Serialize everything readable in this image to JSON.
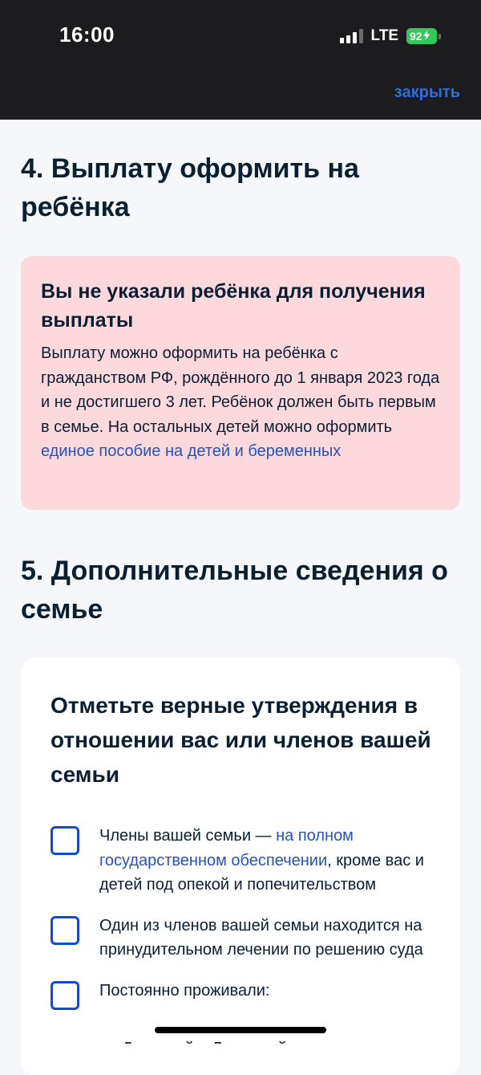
{
  "status_bar": {
    "time": "16:00",
    "network": "LTE",
    "battery": "92",
    "battery_color": "#34c759"
  },
  "header": {
    "close_label": "закрыть"
  },
  "section4": {
    "title": "4. Выплату оформить на ребёнка",
    "warning": {
      "title": "Вы не указали ребёнка для получения выплаты",
      "text_before_link": "Выплату можно оформить на ребёнка с гражданством РФ, рождённого до 1 января 2023 года и не достигшего 3 лет. Ребёнок должен быть первым в семье. На остальных детей можно оформить ",
      "link": "единое пособие на детей и беременных",
      "background_color": "#fdd9de"
    }
  },
  "section5": {
    "title": "5. Дополнительные сведения о семье",
    "card_title": "Отметьте верные утверждения в отношении вас или членов вашей семьи",
    "options": [
      {
        "text_before_link": "Члены вашей семьи — ",
        "link": "на полном государственном обеспечении",
        "text_after_link": ", кроме вас и детей под опекой и попечительством",
        "checked": false
      },
      {
        "text": "Один из членов вашей семьи находится на принудительном лечении по решению суда",
        "checked": false
      },
      {
        "text": "Постоянно проживали:",
        "checked": false
      }
    ],
    "partial_next_line": "Донецкой и Луганской"
  },
  "colors": {
    "accent": "#0d4cd3",
    "link": "#2454b8",
    "header_background": "#1c1c1e",
    "page_background": "#f5f7fb"
  }
}
